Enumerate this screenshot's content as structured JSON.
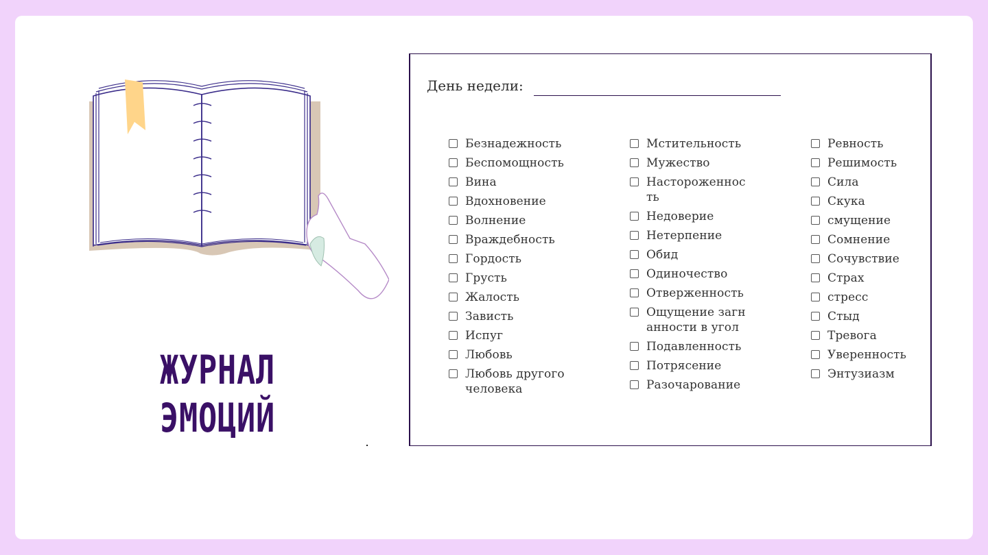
{
  "title": {
    "line1": "ЖУРНАЛ",
    "line2": "ЭМОЦИЙ"
  },
  "form": {
    "day_label": "День недели:"
  },
  "columns": [
    [
      "Безнадежность",
      "Беспомощность",
      "Вина",
      "Вдохновение",
      "Волнение",
      "Враждебность",
      "Гордость",
      "Грусть",
      "Жалость",
      "Зависть",
      "Испуг",
      "Любовь",
      "Любовь другого человека"
    ],
    [
      "Мстительность",
      "Мужество",
      "Настороженность",
      "Недоверие",
      "Нетерпение",
      "Обид",
      "Одиночество",
      "Отверженность",
      "Ощущение загнанности в угол",
      "Подавленность",
      "Потрясение",
      "Разочарование"
    ],
    [
      "Ревность",
      "Решимость",
      "Сила",
      "Скука",
      "смущение",
      "Сомнение",
      "Сочувствие",
      "Страх",
      "стресс",
      "Стыд",
      "Тревога",
      "Уверенность",
      "Энтузиазм"
    ]
  ],
  "icons": {
    "book": "open-book-icon",
    "bookmark": "bookmark-icon",
    "hand": "pointing-hand-icon",
    "checkbox": "checkbox-icon"
  },
  "colors": {
    "background": "#f1d3fb",
    "title": "#3a1066",
    "book_line": "#3b2d8a",
    "bookmark": "#ffd58a",
    "book_shadow": "#d8c7b5"
  }
}
